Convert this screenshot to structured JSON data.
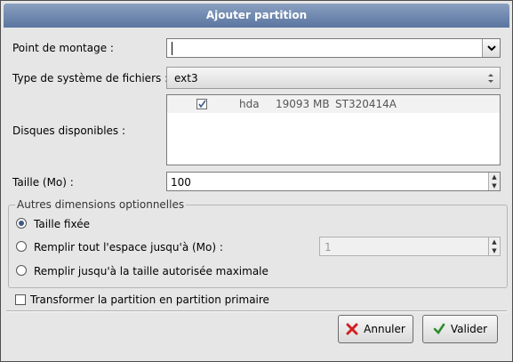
{
  "dialog": {
    "title": "Ajouter partition"
  },
  "mount_point": {
    "label": "Point de montage :",
    "value": ""
  },
  "fs_type": {
    "label": "Type de système de fichiers :",
    "value": "ext3"
  },
  "disks": {
    "label": "Disques disponibles :",
    "rows": [
      {
        "checked": true,
        "drive": "hda",
        "size": "19093 MB",
        "model": "ST320414A"
      }
    ]
  },
  "size": {
    "label": "Taille (Mo) :",
    "value": "100"
  },
  "options": {
    "frame_title": "Autres dimensions optionnelles",
    "fixed": {
      "label": "Taille fixée",
      "selected": true
    },
    "fill_upto": {
      "label": "Remplir tout l'espace jusqu'à (Mo) :",
      "selected": false,
      "value": "1"
    },
    "fill_max": {
      "label": "Remplir jusqu'à la taille autorisée maximale",
      "selected": false
    }
  },
  "primary": {
    "label": "Transformer la partition en partition primaire",
    "checked": false
  },
  "buttons": {
    "cancel": "Annuler",
    "ok": "Valider"
  },
  "colors": {
    "title_bar": "#5a75a0",
    "cancel_icon": "#d32020",
    "ok_icon": "#2e8b2e"
  }
}
